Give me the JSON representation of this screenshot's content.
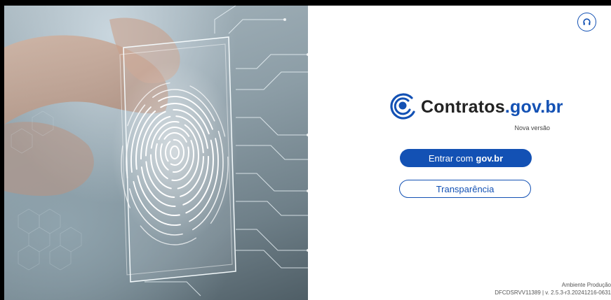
{
  "brand": {
    "name_prefix": "Contratos",
    "name_domain": ".gov.br",
    "subtitle": "Nova versão",
    "accent_color": "#1351b4"
  },
  "actions": {
    "login_prefix": "Entrar com",
    "login_bold": "gov.br",
    "transparency_label": "Transparência"
  },
  "support": {
    "icon": "headset-icon"
  },
  "hero": {
    "image": "fingerprint-touch-illustration"
  },
  "footer": {
    "environment": "Ambiente Produção",
    "version": "DFCDSRVV11389 | v. 2.5.3-r3.20241216-0631"
  }
}
